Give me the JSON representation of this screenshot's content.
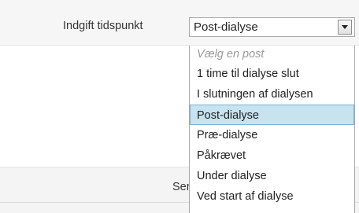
{
  "form": {
    "field_label": "Indgift tidspunkt",
    "selected_value": "Post-dialyse",
    "partial_label": "Ser"
  },
  "dropdown": {
    "options": [
      {
        "label": "Vælg en post",
        "placeholder": true
      },
      {
        "label": "1 time til dialyse slut"
      },
      {
        "label": "I slutningen af dialysen"
      },
      {
        "label": "Post-dialyse",
        "selected": true
      },
      {
        "label": "Præ-dialyse"
      },
      {
        "label": "Påkrævet"
      },
      {
        "label": "Under dialyse"
      },
      {
        "label": "Ved start af dialyse"
      }
    ]
  },
  "colors": {
    "selected_option_bg": "#c7e3f0",
    "selected_option_border": "#7fb3cf",
    "placeholder_text": "#9a9a9a"
  },
  "icons": {
    "dropdown_arrow": "triangle-down-icon"
  }
}
